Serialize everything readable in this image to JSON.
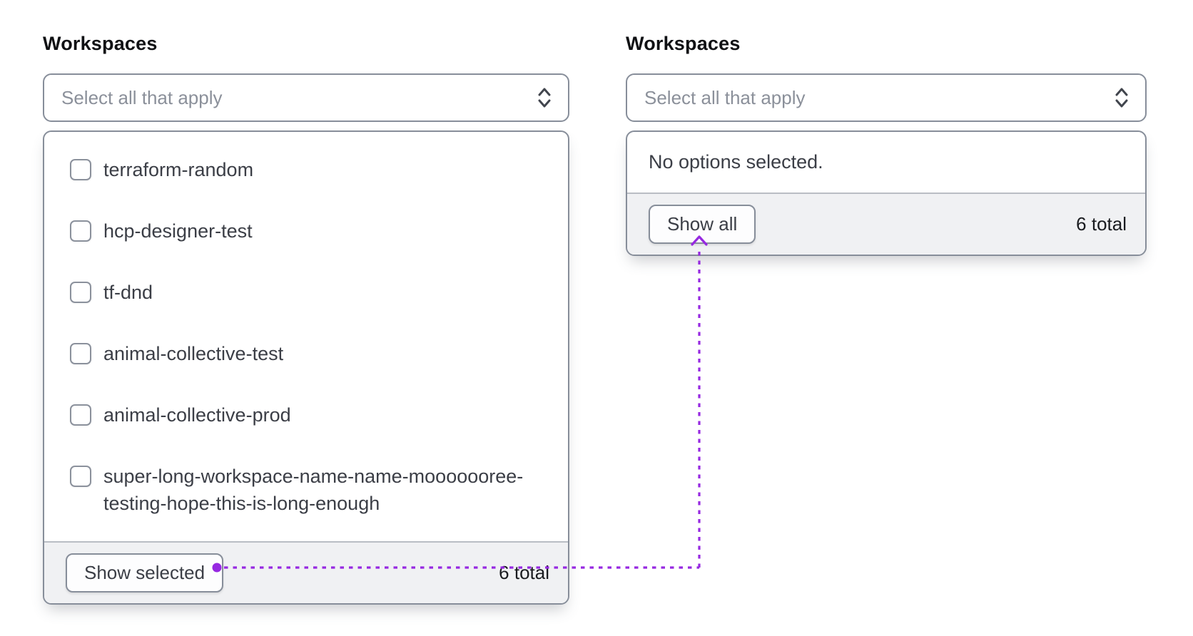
{
  "left_panel": {
    "label": "Workspaces",
    "select": {
      "placeholder": "Select all that apply"
    },
    "options": [
      {
        "label": "terraform-random",
        "checked": false
      },
      {
        "label": "hcp-designer-test",
        "checked": false
      },
      {
        "label": "tf-dnd",
        "checked": false
      },
      {
        "label": "animal-collective-test",
        "checked": false
      },
      {
        "label": "animal-collective-prod",
        "checked": false
      },
      {
        "label": "super-long-workspace-name-name-mooooooree-testing-hope-this-is-long-enough",
        "checked": false
      }
    ],
    "footer": {
      "button_label": "Show selected",
      "total_label": "6 total"
    }
  },
  "right_panel": {
    "label": "Workspaces",
    "select": {
      "placeholder": "Select all that apply"
    },
    "empty_message": "No options selected.",
    "footer": {
      "button_label": "Show all",
      "total_label": "6 total"
    }
  },
  "annotation": {
    "color": "#9628e1",
    "style": "dotted-connector-with-arrow"
  },
  "icons": {
    "select_caret": "chevrons-up-down"
  }
}
